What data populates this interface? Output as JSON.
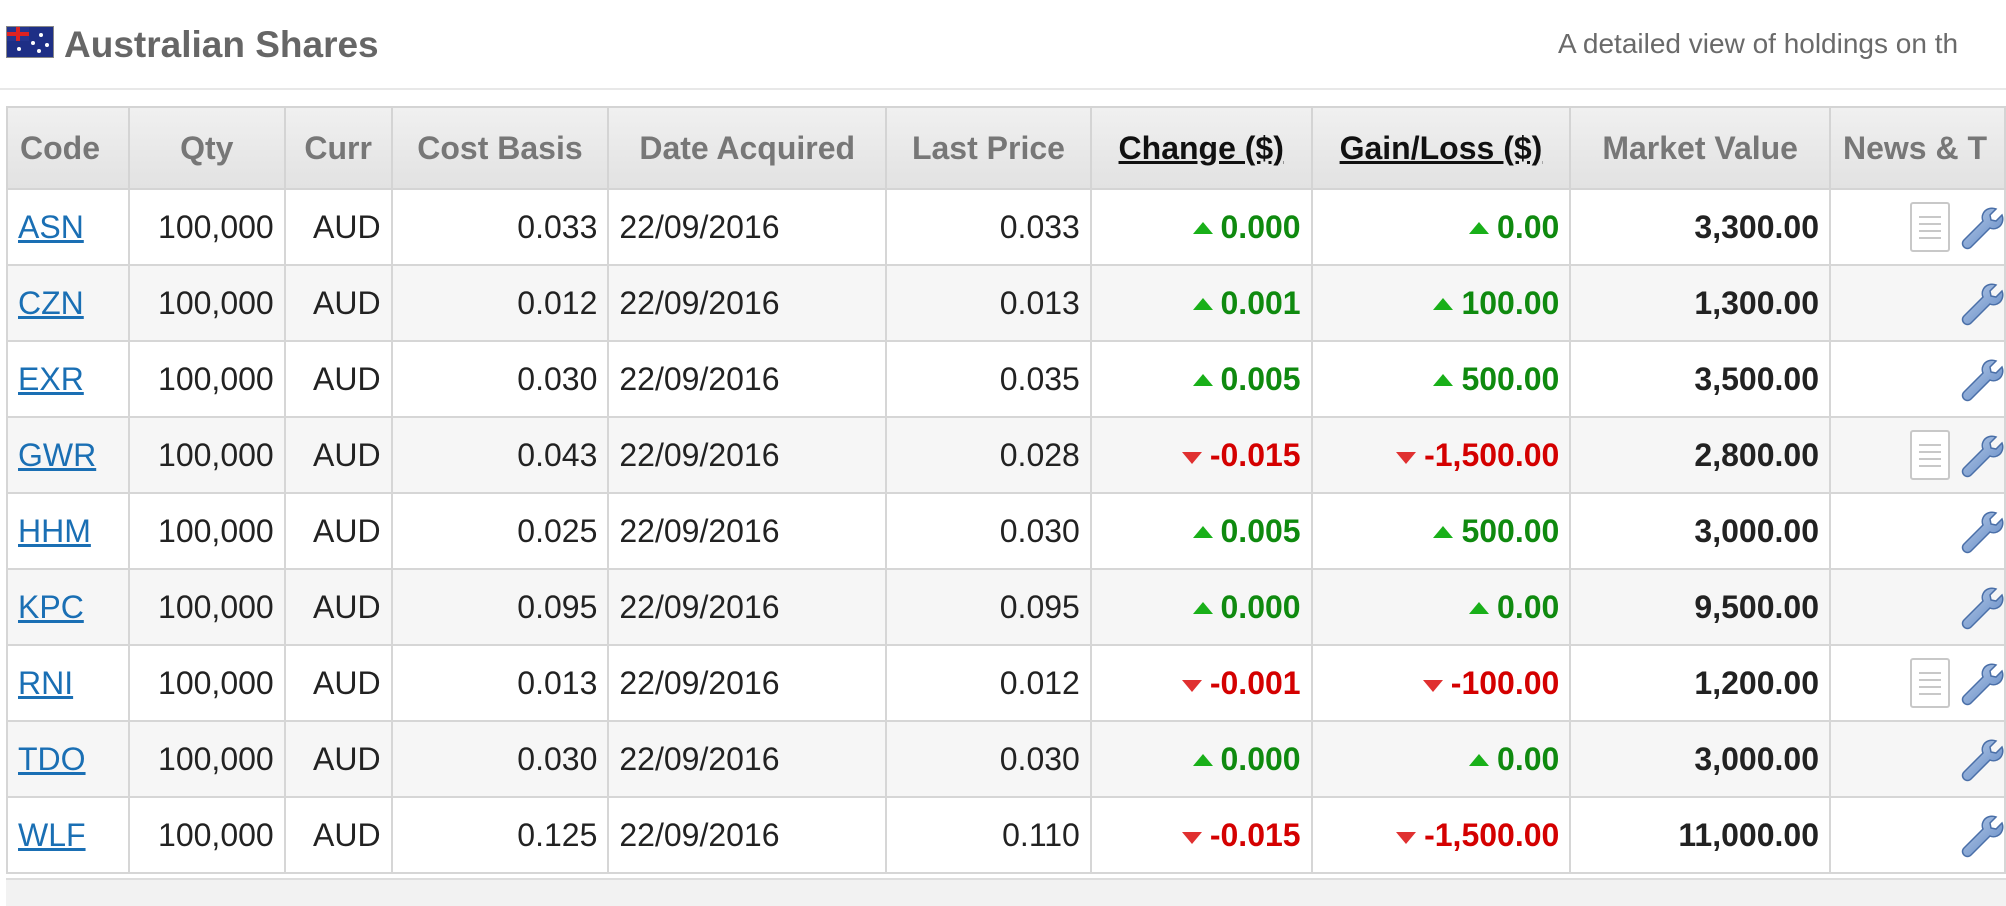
{
  "header": {
    "title": "Australian Shares",
    "subtitle": "A detailed view of holdings on th"
  },
  "columns": {
    "code": "Code",
    "qty": "Qty",
    "curr": "Curr",
    "cost_basis": "Cost Basis",
    "date_acquired": "Date Acquired",
    "last_price": "Last Price",
    "change": "Change ($)",
    "gain_loss": "Gain/Loss ($)",
    "market_value": "Market Value",
    "news": "News & T"
  },
  "colors": {
    "up": "#0f8a0f",
    "down": "#d40000",
    "link": "#1a6fb4"
  },
  "rows": [
    {
      "code": "ASN",
      "qty": "100,000",
      "curr": "AUD",
      "cost": "0.033",
      "date": "22/09/2016",
      "last": "0.033",
      "change": "0.000",
      "gain": "0.00",
      "value": "3,300.00",
      "dir": "up",
      "news": true
    },
    {
      "code": "CZN",
      "qty": "100,000",
      "curr": "AUD",
      "cost": "0.012",
      "date": "22/09/2016",
      "last": "0.013",
      "change": "0.001",
      "gain": "100.00",
      "value": "1,300.00",
      "dir": "up",
      "news": false
    },
    {
      "code": "EXR",
      "qty": "100,000",
      "curr": "AUD",
      "cost": "0.030",
      "date": "22/09/2016",
      "last": "0.035",
      "change": "0.005",
      "gain": "500.00",
      "value": "3,500.00",
      "dir": "up",
      "news": false
    },
    {
      "code": "GWR",
      "qty": "100,000",
      "curr": "AUD",
      "cost": "0.043",
      "date": "22/09/2016",
      "last": "0.028",
      "change": "-0.015",
      "gain": "-1,500.00",
      "value": "2,800.00",
      "dir": "down",
      "news": true
    },
    {
      "code": "HHM",
      "qty": "100,000",
      "curr": "AUD",
      "cost": "0.025",
      "date": "22/09/2016",
      "last": "0.030",
      "change": "0.005",
      "gain": "500.00",
      "value": "3,000.00",
      "dir": "up",
      "news": false
    },
    {
      "code": "KPC",
      "qty": "100,000",
      "curr": "AUD",
      "cost": "0.095",
      "date": "22/09/2016",
      "last": "0.095",
      "change": "0.000",
      "gain": "0.00",
      "value": "9,500.00",
      "dir": "up",
      "news": false
    },
    {
      "code": "RNI",
      "qty": "100,000",
      "curr": "AUD",
      "cost": "0.013",
      "date": "22/09/2016",
      "last": "0.012",
      "change": "-0.001",
      "gain": "-100.00",
      "value": "1,200.00",
      "dir": "down",
      "news": true
    },
    {
      "code": "TDO",
      "qty": "100,000",
      "curr": "AUD",
      "cost": "0.030",
      "date": "22/09/2016",
      "last": "0.030",
      "change": "0.000",
      "gain": "0.00",
      "value": "3,000.00",
      "dir": "up",
      "news": false
    },
    {
      "code": "WLF",
      "qty": "100,000",
      "curr": "AUD",
      "cost": "0.125",
      "date": "22/09/2016",
      "last": "0.110",
      "change": "-0.015",
      "gain": "-1,500.00",
      "value": "11,000.00",
      "dir": "down",
      "news": false
    }
  ]
}
